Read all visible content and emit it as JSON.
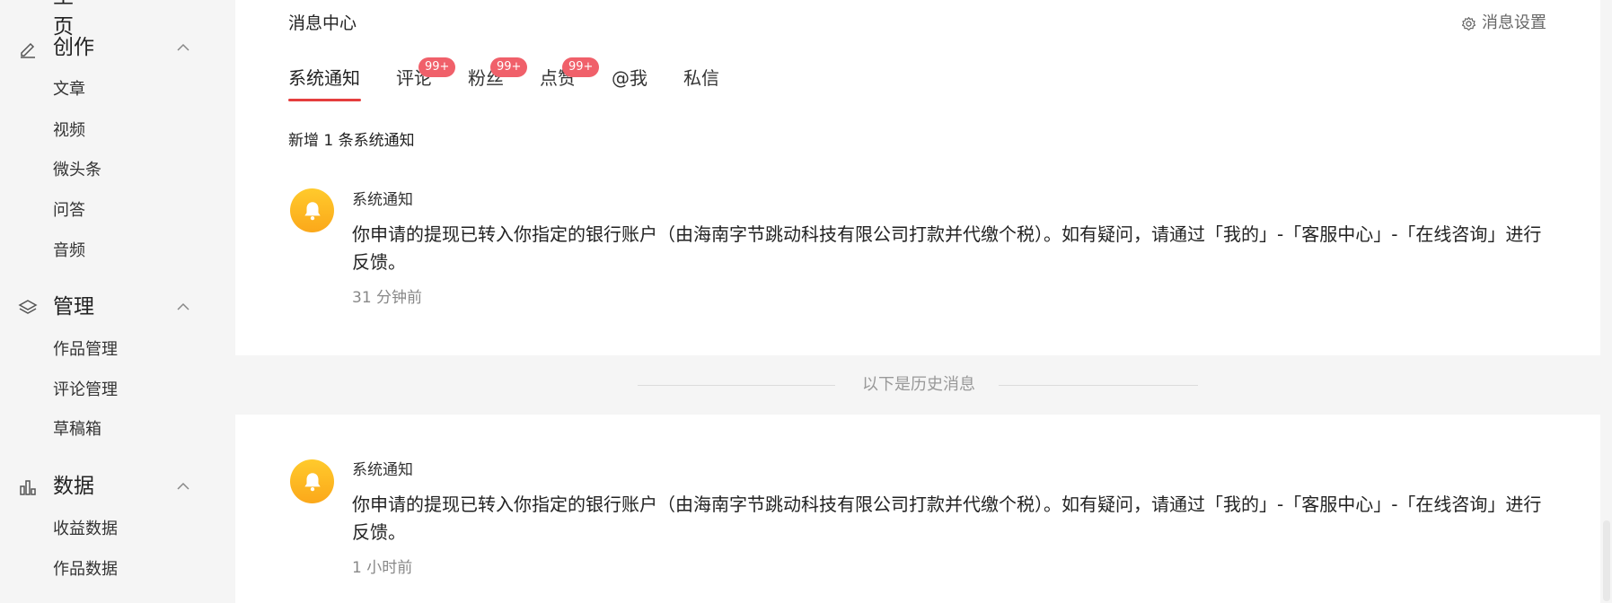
{
  "sidebar": {
    "top_cut_label": "主页",
    "groups": [
      {
        "label": "创作",
        "icon": "pen-icon",
        "items": [
          "文章",
          "视频",
          "微头条",
          "问答",
          "音频"
        ]
      },
      {
        "label": "管理",
        "icon": "layers-icon",
        "items": [
          "作品管理",
          "评论管理",
          "草稿箱"
        ]
      },
      {
        "label": "数据",
        "icon": "bar-chart-icon",
        "items": [
          "收益数据",
          "作品数据"
        ]
      }
    ]
  },
  "header": {
    "title": "消息中心",
    "settings_label": "消息设置",
    "settings_icon": "gear-icon"
  },
  "tabs": [
    {
      "label": "系统通知",
      "active": true,
      "badge": ""
    },
    {
      "label": "评论",
      "active": false,
      "badge": "99+"
    },
    {
      "label": "粉丝",
      "active": false,
      "badge": "99+"
    },
    {
      "label": "点赞",
      "active": false,
      "badge": "99+"
    },
    {
      "label": "@我",
      "active": false,
      "badge": ""
    },
    {
      "label": "私信",
      "active": false,
      "badge": ""
    }
  ],
  "new_count_text": "新增 1 条系统通知",
  "history_separator": "以下是历史消息",
  "messages": [
    {
      "sender": "系统通知",
      "body": "你申请的提现已转入你指定的银行账户（由海南字节跳动科技有限公司打款并代缴个税）。如有疑问，请通过「我的」-「客服中心」-「在线咨询」进行反馈。",
      "time": "31 分钟前",
      "icon": "bell-icon"
    },
    {
      "sender": "系统通知",
      "body": "你申请的提现已转入你指定的银行账户（由海南字节跳动科技有限公司打款并代缴个税）。如有疑问，请通过「我的」-「客服中心」-「在线咨询」进行反馈。",
      "time": "1 小时前",
      "icon": "bell-icon"
    }
  ],
  "colors": {
    "accent": "#e53e3e",
    "badge": "#f0606a",
    "avatar": "#fbb826"
  }
}
